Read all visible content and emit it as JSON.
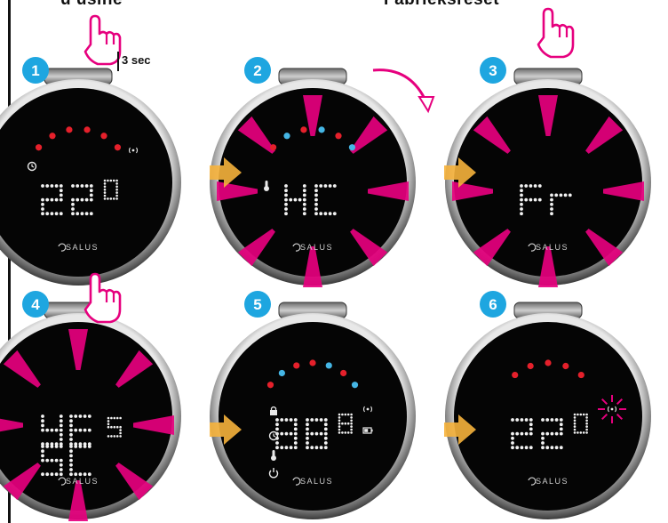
{
  "headers": {
    "left": "u usine",
    "right": "Fabrieksreset"
  },
  "hold_label": "3 sec",
  "brand": "SALUS",
  "colors": {
    "accent_pink": "#e6007e",
    "step_badge": "#1ea6e0",
    "arrow": "#f6b23c",
    "led_red": "#e5202b",
    "led_blue": "#45b6e5"
  },
  "steps": [
    {
      "number": "1",
      "display": "22",
      "small_display": "0",
      "touch": true,
      "leds": [
        "red",
        "red",
        "red",
        "red",
        "red",
        "red"
      ],
      "icons": [
        "clock-icon",
        "wifi-signal-icon"
      ],
      "rays": false
    },
    {
      "number": "2",
      "display": "HC",
      "small_display": "",
      "touch": false,
      "leds": [
        "red",
        "blue",
        "red",
        "blue",
        "red",
        "blue"
      ],
      "icons": [
        "thermometer-icon"
      ],
      "rays": true,
      "rotate_arrow": true
    },
    {
      "number": "3",
      "display": "Fr",
      "small_display": "",
      "touch": true,
      "leds": [],
      "icons": [],
      "rays": true
    },
    {
      "number": "4",
      "display": "YES",
      "small_display": "5",
      "touch": true,
      "leds": [],
      "icons": [],
      "rays": true
    },
    {
      "number": "5",
      "display": "88",
      "small_display": "8",
      "touch": false,
      "leds": [
        "red",
        "blue",
        "red",
        "red",
        "blue",
        "red",
        "blue"
      ],
      "icons": [
        "lock-icon",
        "clock-icon",
        "thermometer-icon",
        "power-icon",
        "wifi-signal-icon",
        "battery-icon"
      ],
      "rays": false
    },
    {
      "number": "6",
      "display": "22",
      "small_display": "0",
      "touch": false,
      "leds": [
        "red",
        "red",
        "red",
        "red",
        "red"
      ],
      "icons": [
        "wifi-signal-icon"
      ],
      "rays": false,
      "blink_wifi": true
    }
  ]
}
